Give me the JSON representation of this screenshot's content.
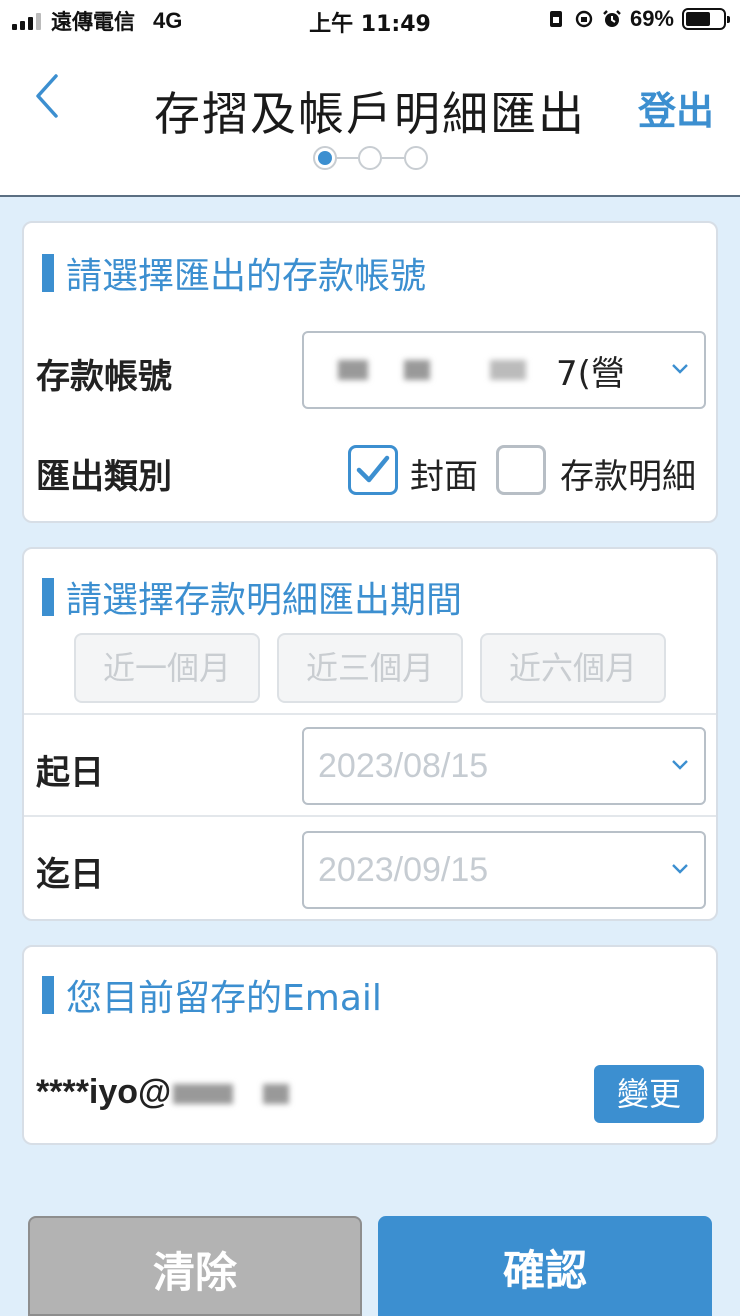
{
  "status_bar": {
    "carrier": "遠傳電信",
    "network": "4G",
    "time": "上午 11:49",
    "battery": "69%"
  },
  "header": {
    "title": "存摺及帳戶明細匯出",
    "logout_label": "登出",
    "steps_total": 3,
    "steps_current": 1
  },
  "account_section": {
    "title": "請選擇匯出的存款帳號",
    "account_label": "存款帳號",
    "account_value_suffix": "7(營",
    "type_label": "匯出類別",
    "options": [
      {
        "label": "封面",
        "checked": true
      },
      {
        "label": "存款明細",
        "checked": false
      }
    ]
  },
  "period_section": {
    "title": "請選擇存款明細匯出期間",
    "quick_buttons": [
      "近一個月",
      "近三個月",
      "近六個月"
    ],
    "start_label": "起日",
    "start_value": "2023/08/15",
    "end_label": "迄日",
    "end_value": "2023/09/15"
  },
  "email_section": {
    "title": "您目前留存的Email",
    "email_prefix": "****iyo@",
    "change_label": "變更"
  },
  "footer": {
    "clear_label": "清除",
    "confirm_label": "確認"
  },
  "colors": {
    "accent": "#3c8fd0",
    "background": "#dfeefa",
    "clear_button": "#b3b3b3"
  }
}
